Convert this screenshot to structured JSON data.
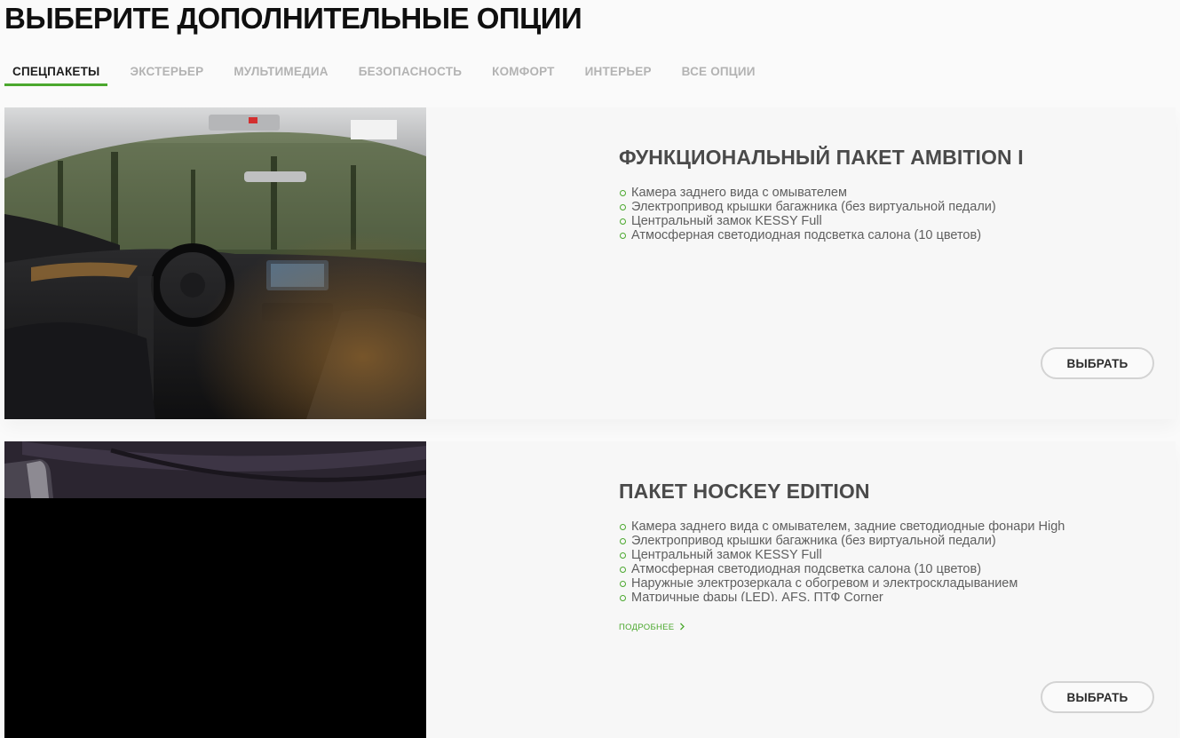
{
  "page": {
    "title": "ВЫБЕРИТЕ ДОПОЛНИТЕЛЬНЫЕ ОПЦИИ"
  },
  "tabs": [
    {
      "label": "СПЕЦПАКЕТЫ",
      "active": true
    },
    {
      "label": "ЭКСТЕРЬЕР",
      "active": false
    },
    {
      "label": "МУЛЬТИМЕДИА",
      "active": false
    },
    {
      "label": "БЕЗОПАСНОСТЬ",
      "active": false
    },
    {
      "label": "КОМФОРТ",
      "active": false
    },
    {
      "label": "ИНТЕРЬЕР",
      "active": false
    },
    {
      "label": "ВСЕ ОПЦИИ",
      "active": false
    }
  ],
  "packages": [
    {
      "title": "ФУНКЦИОНАЛЬНЫЙ ПАКЕТ AMBITION I",
      "features": [
        "Камера заднего вида с омывателем",
        "Электропривод крышки багажника (без виртуальной педали)",
        "Центральный замок KESSY Full",
        "Атмосферная светодиодная подсветка салона (10 цветов)"
      ],
      "button_label": "ВЫБРАТЬ"
    },
    {
      "title": "ПАКЕТ HOCKEY EDITION",
      "features": [
        "Камера заднего вида с омывателем, задние светодиодные фонари High",
        "Электропривод крышки багажника (без виртуальной педали)",
        "Центральный замок KESSY Full",
        "Атмосферная светодиодная подсветка салона (10 цветов)",
        "Наружные электрозеркала с обогревом и электроскладыванием",
        "Матричные фары (LED), AFS, ПТФ Corner"
      ],
      "more_label": "ПОДРОБНЕЕ",
      "button_label": "ВЫБРАТЬ"
    }
  ],
  "colors": {
    "accent": "#4ba82e",
    "page_background": "#fafafa",
    "card_background": "#f7f7f7",
    "tab_inactive": "#b3b3b3"
  }
}
